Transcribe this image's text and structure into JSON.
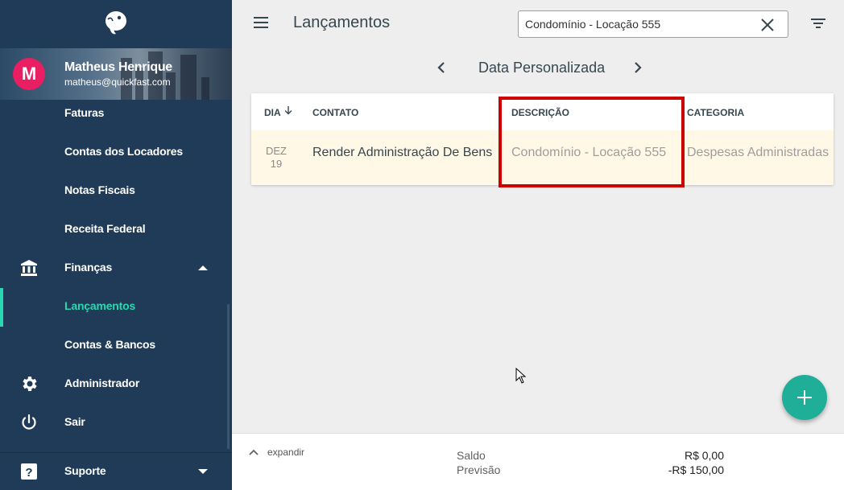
{
  "sidebar": {
    "user": {
      "initial": "M",
      "name": "Matheus Henrique",
      "email": "matheus@quickfast.com",
      "avatar_color": "#e91e63"
    },
    "items": [
      {
        "label": "Faturas"
      },
      {
        "label": "Contas dos Locadores"
      },
      {
        "label": "Notas Fiscais"
      },
      {
        "label": "Receita Federal"
      },
      {
        "label": "Finanças",
        "icon": "bank-icon",
        "expanded": true
      },
      {
        "label": "Lançamentos",
        "active": true
      },
      {
        "label": "Contas & Bancos"
      },
      {
        "label": "Administrador",
        "icon": "gear-icon"
      },
      {
        "label": "Sair",
        "icon": "power-icon"
      },
      {
        "label": "Suporte",
        "icon": "help-icon",
        "expanded": false
      }
    ],
    "colors": {
      "background": "#1f3b57",
      "active": "#26d9b1"
    }
  },
  "header": {
    "title": "Lançamentos",
    "search_value": "Condomínio - Locação 555"
  },
  "date_nav": {
    "label": "Data Personalizada"
  },
  "table": {
    "columns": [
      "DIA",
      "CONTATO",
      "DESCRIÇÃO",
      "CATEGORIA"
    ],
    "rows": [
      {
        "month": "DEZ",
        "day": "19",
        "contato": "Render Administração De Bens",
        "descricao": "Condomínio - Locação 555",
        "categoria": "Despesas Administradas"
      }
    ]
  },
  "footer": {
    "expand_label": "expandir",
    "saldo_label": "Saldo",
    "saldo_value": "R$ 0,00",
    "previsao_label": "Previsão",
    "previsao_value": "-R$ 150,00"
  },
  "fab": {
    "icon": "plus-icon",
    "color": "#1fae98"
  }
}
